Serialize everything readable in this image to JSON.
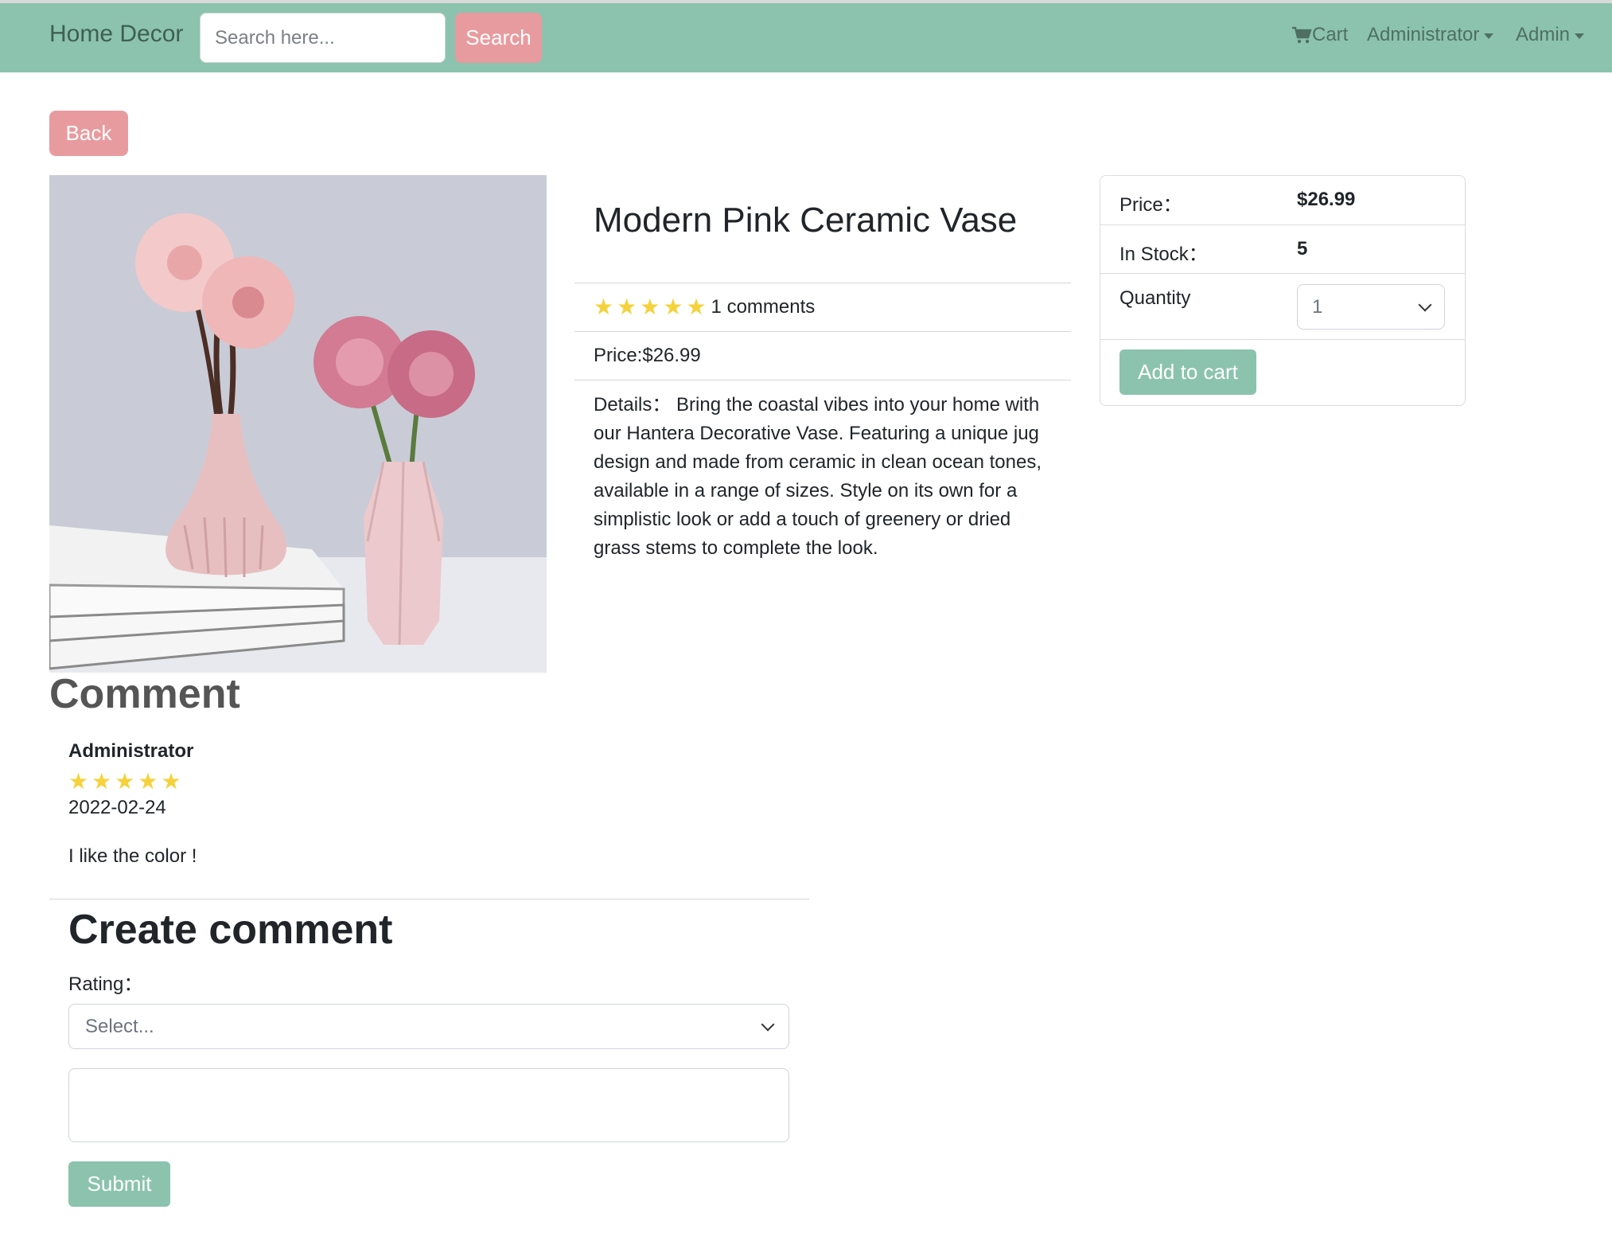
{
  "colors": {
    "nav_bg": "#8bc3ae",
    "accent_pink": "#e89b9e",
    "accent_green": "#8bc3ae",
    "star": "#f5d23a"
  },
  "navbar": {
    "brand": "Home Decor",
    "search_placeholder": "Search here...",
    "search_button": "Search",
    "cart": "Cart",
    "cart_icon": "cart-icon",
    "menu1": "Administrator",
    "menu2": "Admin"
  },
  "back_button": "Back",
  "product": {
    "title": "Modern Pink Ceramic Vase",
    "rating_stars": 5,
    "comments_text": "1 comments",
    "price_line": "Price:$26.99",
    "details": "Details： Bring the coastal vibes into your home with our Hantera Decorative Vase. Featuring a unique jug design and made from ceramic in clean ocean tones, available in a range of sizes. Style on its own for a simplistic look or add a touch of greenery or dried grass stems to complete the look."
  },
  "card": {
    "price_label": "Price：",
    "price_value": "$26.99",
    "stock_label": "In Stock：",
    "stock_value": "5",
    "quantity_label": "Quantity",
    "quantity_value": "1",
    "add_to_cart": "Add to cart"
  },
  "comments": {
    "heading": "Comment",
    "items": [
      {
        "author": "Administrator",
        "stars": 5,
        "date": "2022-02-24",
        "text": "I like the color !"
      }
    ]
  },
  "create_comment": {
    "heading": "Create comment",
    "rating_label": "Rating：",
    "rating_placeholder": "Select...",
    "submit": "Submit"
  }
}
